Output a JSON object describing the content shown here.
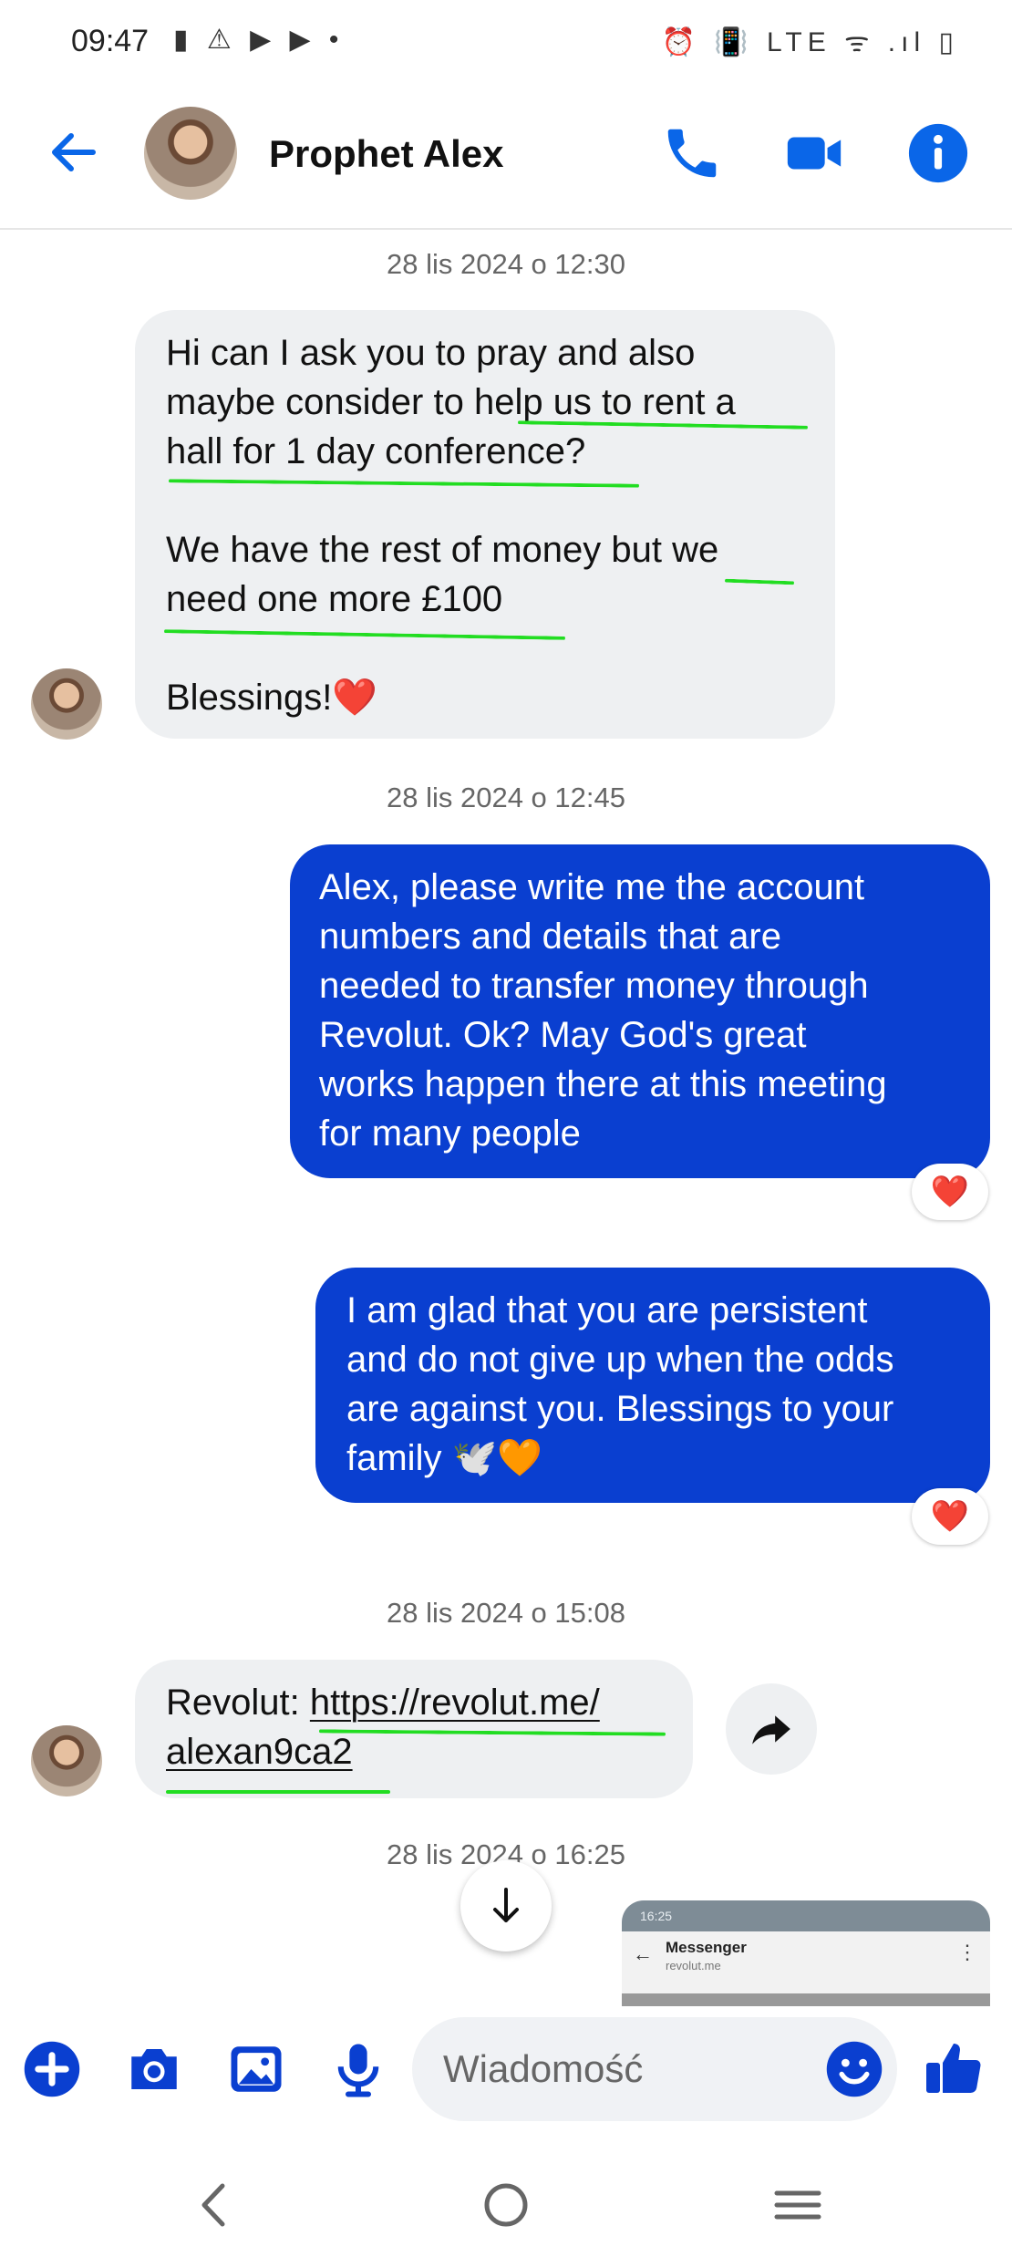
{
  "status_bar": {
    "time": "09:47",
    "left_icons": "▮ ⚠ ▶ ▶ •",
    "right_icons": "⏰ 📳 LTE ᯤ .ıl ▯"
  },
  "header": {
    "contact_name": "Prophet Alex",
    "icons": [
      "back-arrow-icon",
      "phone-icon",
      "video-camera-icon",
      "info-icon"
    ],
    "accent_color": "#0a66e8"
  },
  "messages": [
    {
      "timestamp": "28 lis 2024 o 12:30",
      "direction": "incoming",
      "lines": [
        "Hi can I ask you to pray and also",
        "maybe consider to help us to rent a",
        "hall for 1 day conference?",
        "",
        "We have the rest of money but we",
        "need one more  £100",
        "",
        "Blessings!❤️"
      ]
    },
    {
      "timestamp": "28 lis 2024 o 12:45",
      "direction": "outgoing",
      "lines": [
        "Alex, please write me the account",
        "numbers and details that are",
        "needed to transfer money through",
        "Revolut. Ok? May God's great",
        "works happen there at this meeting",
        "for many people"
      ],
      "reaction": "❤️"
    },
    {
      "direction": "outgoing",
      "lines": [
        "I am glad that you are persistent",
        "and do not give up when the odds",
        "are against you. Blessings to your",
        "family 🕊️🧡"
      ],
      "reaction": "❤️"
    },
    {
      "timestamp": "28 lis 2024 o 15:08",
      "direction": "incoming",
      "prefix": "Revolut: ",
      "link_line1": "https://revolut.me/",
      "link_line2": "alexan9ca2"
    },
    {
      "timestamp": "28 lis 2024 o 16:25"
    }
  ],
  "preview_thumbnail": {
    "status_time": "16:25",
    "app_title": "Messenger",
    "url": "revolut.me"
  },
  "composer": {
    "placeholder": "Wiadomość",
    "icons": [
      "plus-icon",
      "camera-icon",
      "gallery-icon",
      "microphone-icon",
      "emoji-icon",
      "thumbs-up-icon"
    ]
  },
  "nav_bar": {
    "icons": [
      "nav-back-icon",
      "nav-home-icon",
      "nav-recents-icon"
    ]
  },
  "colors": {
    "outgoing_bubble": "#0a3fd0",
    "incoming_bubble": "#eef0f2",
    "highlight_marker": "#22dd22",
    "icon_blue": "#0a66e8",
    "composer_blue": "#0a3fd0"
  }
}
